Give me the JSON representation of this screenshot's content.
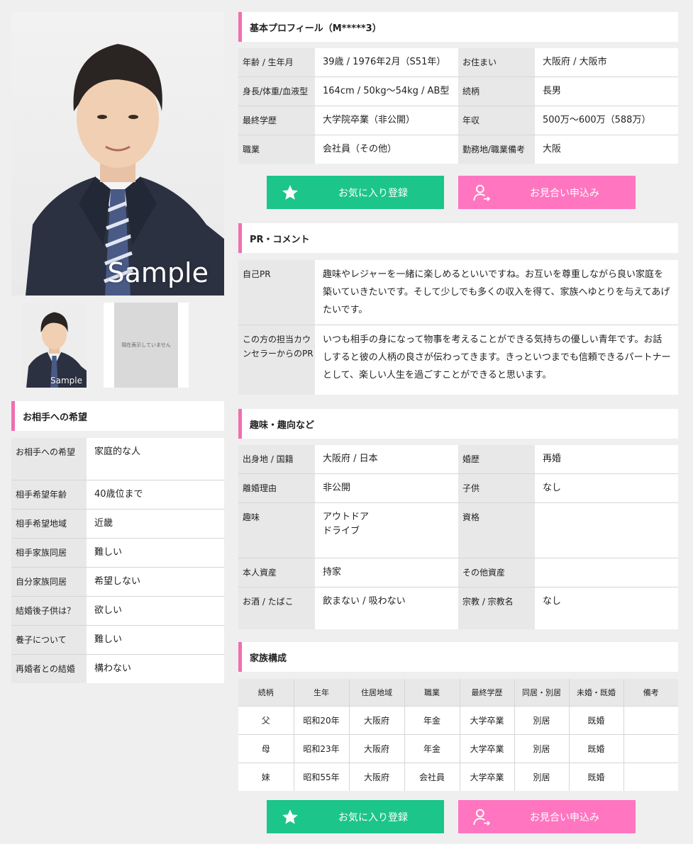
{
  "photo": {
    "watermark": "Sample"
  },
  "thumbs": [
    {
      "watermark": "Sample"
    },
    {
      "placeholder": "現在表示していません"
    }
  ],
  "preferences": {
    "title": "お相手への希望",
    "rows": [
      {
        "label": "お相手への希望",
        "value": "家庭的な人"
      },
      {
        "label": "相手希望年齢",
        "value": "40歳位まで"
      },
      {
        "label": "相手希望地域",
        "value": "近畿"
      },
      {
        "label": "相手家族同居",
        "value": "難しい"
      },
      {
        "label": "自分家族同居",
        "value": "希望しない"
      },
      {
        "label": "結婚後子供は？",
        "value": "欲しい"
      },
      {
        "label": "養子について",
        "value": "難しい"
      },
      {
        "label": "再婚者との結婚",
        "value": "構わない"
      }
    ]
  },
  "basic": {
    "title": "基本プロフィール（M*****3）",
    "rows": [
      {
        "k1": "年齢 / 生年月",
        "v1": "39歳 / 1976年2月（S51年）",
        "k2": "お住まい",
        "v2": "大阪府 / 大阪市"
      },
      {
        "k1": "身長/体重/血液型",
        "v1": "164cm / 50kg～54kg / AB型",
        "k2": "続柄",
        "v2": "長男"
      },
      {
        "k1": "最終学歴",
        "v1": "大学院卒業（非公開）",
        "k2": "年収",
        "v2": "500万～600万（588万）"
      },
      {
        "k1": "職業",
        "v1": "会社員（その他）",
        "k2": "勤務地/職業備考",
        "v2": "大阪"
      }
    ]
  },
  "buttons": {
    "favorite": "お気に入り登録",
    "apply": "お見合い申込み"
  },
  "pr": {
    "title": "PR・コメント",
    "self_label": "自己PR",
    "self_text": "趣味やレジャーを一緒に楽しめるといいですね。お互いを尊重しながら良い家庭を築いていきたいです。そして少しでも多くの収入を得て、家族へゆとりを与えてあげたいです。",
    "counselor_label": "この方の担当カウンセラーからのPR",
    "counselor_text": "いつも相手の身になって物事を考えることができる気持ちの優しい青年です。お話しすると彼の人柄の良さが伝わってきます。きっといつまでも信頼できるパートナーとして、楽しい人生を過ごすことができると思います。"
  },
  "hobby": {
    "title": "趣味・趣向など",
    "rows": [
      {
        "k1": "出身地 / 国籍",
        "v1": "大阪府 / 日本",
        "k2": "婚歴",
        "v2": "再婚"
      },
      {
        "k1": "離婚理由",
        "v1": "非公開",
        "k2": "子供",
        "v2": "なし"
      },
      {
        "k1": "趣味",
        "v1": "アウトドア\nドライブ",
        "k2": "資格",
        "v2": ""
      },
      {
        "k1": "本人資産",
        "v1": "持家",
        "k2": "その他資産",
        "v2": ""
      },
      {
        "k1": "お酒 / たばこ",
        "v1": "飲まない / 吸わない",
        "k2": "宗教 / 宗教名",
        "v2": "なし"
      }
    ]
  },
  "family": {
    "title": "家族構成",
    "headers": [
      "続柄",
      "生年",
      "住居地域",
      "職業",
      "最終学歴",
      "同居・別居",
      "未婚・既婚",
      "備考"
    ],
    "rows": [
      [
        "父",
        "昭和20年",
        "大阪府",
        "年金",
        "大学卒業",
        "別居",
        "既婚",
        ""
      ],
      [
        "母",
        "昭和23年",
        "大阪府",
        "年金",
        "大学卒業",
        "別居",
        "既婚",
        ""
      ],
      [
        "妹",
        "昭和55年",
        "大阪府",
        "会社員",
        "大学卒業",
        "別居",
        "既婚",
        ""
      ]
    ]
  }
}
